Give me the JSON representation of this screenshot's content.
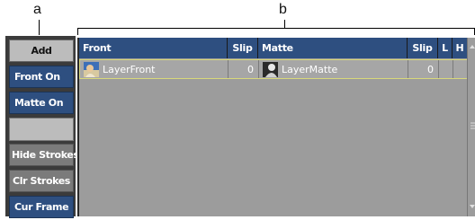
{
  "callouts": {
    "left": "a",
    "right": "b"
  },
  "panel": {
    "buttons": [
      {
        "label": "Add"
      },
      {
        "label": "Front On"
      },
      {
        "label": "Matte On"
      },
      {
        "label": ""
      },
      {
        "label": "Hide Strokes"
      },
      {
        "label": "Clr Strokes"
      },
      {
        "label": "Cur Frame"
      }
    ]
  },
  "table": {
    "headers": {
      "front": "Front",
      "slip1": "Slip",
      "matte": "Matte",
      "slip2": "Slip",
      "l": "L",
      "h": "H"
    },
    "rows": [
      {
        "front": "LayerFront",
        "slip1": "0",
        "matte": "LayerMatte",
        "slip2": "0"
      }
    ]
  }
}
